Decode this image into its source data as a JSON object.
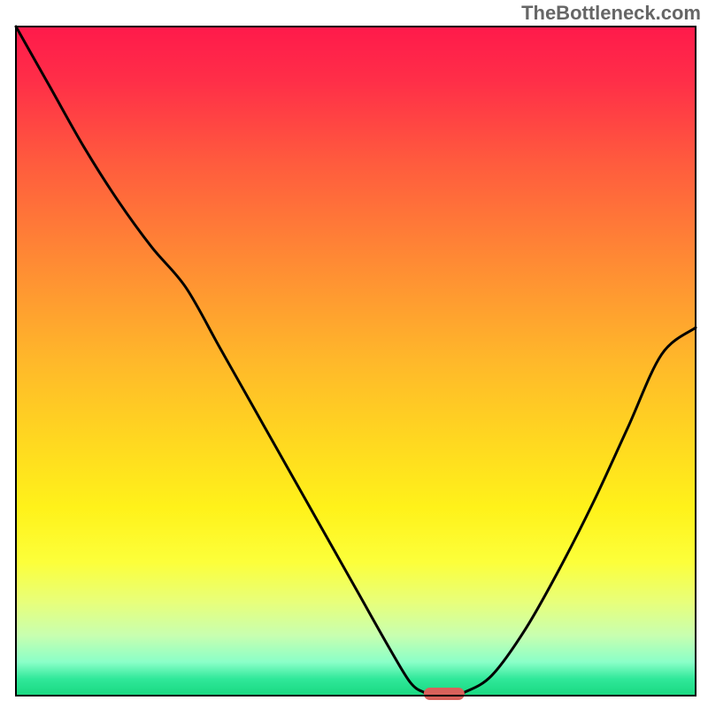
{
  "watermark": "TheBottleneck.com",
  "chart_data": {
    "type": "line",
    "title": "",
    "xlabel": "",
    "ylabel": "",
    "xlim": [
      0,
      100
    ],
    "ylim": [
      0,
      100
    ],
    "grid": false,
    "legend": false,
    "x": [
      0,
      5,
      10,
      15,
      20,
      25,
      30,
      35,
      40,
      45,
      50,
      55,
      58,
      60,
      62,
      64,
      66,
      70,
      75,
      80,
      85,
      90,
      95,
      100
    ],
    "y": [
      100,
      91,
      82,
      74,
      67,
      61,
      52,
      43,
      34,
      25,
      16,
      7,
      2,
      0.5,
      0,
      0,
      0.5,
      3,
      10,
      19,
      29,
      40,
      51,
      55
    ],
    "optimal_x": 63,
    "marker": {
      "x_start": 60,
      "x_end": 66,
      "color": "#d9615b"
    },
    "gradient_stops": [
      {
        "offset": 0.0,
        "color": "#ff1a4b"
      },
      {
        "offset": 0.08,
        "color": "#ff2e48"
      },
      {
        "offset": 0.2,
        "color": "#ff5a3e"
      },
      {
        "offset": 0.35,
        "color": "#ff8a34"
      },
      {
        "offset": 0.5,
        "color": "#ffb82a"
      },
      {
        "offset": 0.62,
        "color": "#ffd820"
      },
      {
        "offset": 0.72,
        "color": "#fff21a"
      },
      {
        "offset": 0.8,
        "color": "#fcff3a"
      },
      {
        "offset": 0.86,
        "color": "#e8ff7a"
      },
      {
        "offset": 0.91,
        "color": "#c8ffb0"
      },
      {
        "offset": 0.95,
        "color": "#8affc8"
      },
      {
        "offset": 0.975,
        "color": "#30e89a"
      },
      {
        "offset": 1.0,
        "color": "#18d880"
      }
    ],
    "plot_border_color": "#000000",
    "plot_border_width": 2,
    "curve_color": "#000000",
    "curve_width": 3
  }
}
